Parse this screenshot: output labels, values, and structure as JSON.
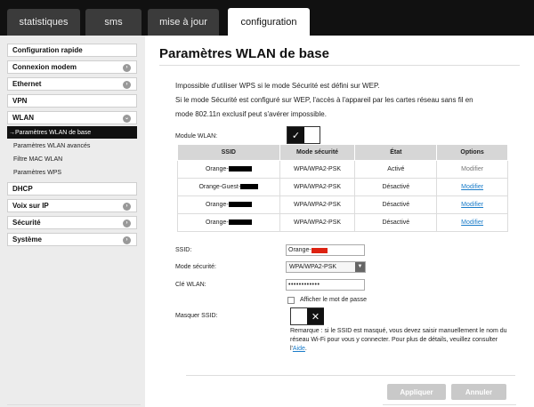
{
  "tabs": [
    {
      "label": "statistiques"
    },
    {
      "label": "sms"
    },
    {
      "label": "mise à jour"
    },
    {
      "label": "configuration"
    }
  ],
  "sidebar": {
    "items": [
      {
        "label": "Configuration rapide"
      },
      {
        "label": "Connexion modem"
      },
      {
        "label": "Ethernet"
      },
      {
        "label": "VPN"
      },
      {
        "label": "WLAN"
      },
      {
        "label": "DHCP"
      },
      {
        "label": "Voix sur IP"
      },
      {
        "label": "Sécurité"
      },
      {
        "label": "Système"
      }
    ],
    "wlan_sub": [
      {
        "label": "Paramètres WLAN de base"
      },
      {
        "label": "Paramètres WLAN avancés"
      },
      {
        "label": "Filtre MAC WLAN"
      },
      {
        "label": "Paramètres WPS"
      }
    ]
  },
  "main": {
    "title": "Paramètres WLAN de base",
    "info1": "Impossible d'utiliser WPS si le mode Sécurité est défini sur WEP.",
    "info2": "Si le mode Sécurité est configuré sur WEP, l'accès à l'appareil par les cartes réseau sans fil en",
    "info3": "mode 802.11n exclusif peut s'avérer impossible.",
    "module_label": "Module WLAN:",
    "table": {
      "headers": [
        "SSID",
        "Mode sécurité",
        "État",
        "Options"
      ],
      "rows": [
        {
          "ssid": "Orange-",
          "mode": "WPA/WPA2-PSK",
          "state": "Activé",
          "option": "Modifier"
        },
        {
          "ssid": "Orange-Guest-",
          "mode": "WPA/WPA2-PSK",
          "state": "Désactivé",
          "option": "Modifier"
        },
        {
          "ssid": "Orange-",
          "mode": "WPA/WPA2-PSK",
          "state": "Désactivé",
          "option": "Modifier"
        },
        {
          "ssid": "Orange-",
          "mode": "WPA/WPA2-PSK",
          "state": "Désactivé",
          "option": "Modifier"
        }
      ]
    },
    "form": {
      "ssid_label": "SSID:",
      "ssid_value": "Orange-",
      "security_label": "Mode sécurité:",
      "security_value": "WPA/WPA2-PSK",
      "key_label": "Clé WLAN:",
      "key_value": "••••••••••••",
      "show_password_label": "Afficher le mot de passe",
      "hide_ssid_label": "Masquer SSID:",
      "note_text": "Remarque : si le SSID est masqué, vous devez saisir manuellement le nom du réseau Wi-Fi pour vous y connecter. Pour plus de détails, veuillez consulter l'",
      "note_link": "Aide",
      "note_end": "."
    },
    "buttons": {
      "apply": "Appliquer",
      "cancel": "Annuler"
    }
  }
}
